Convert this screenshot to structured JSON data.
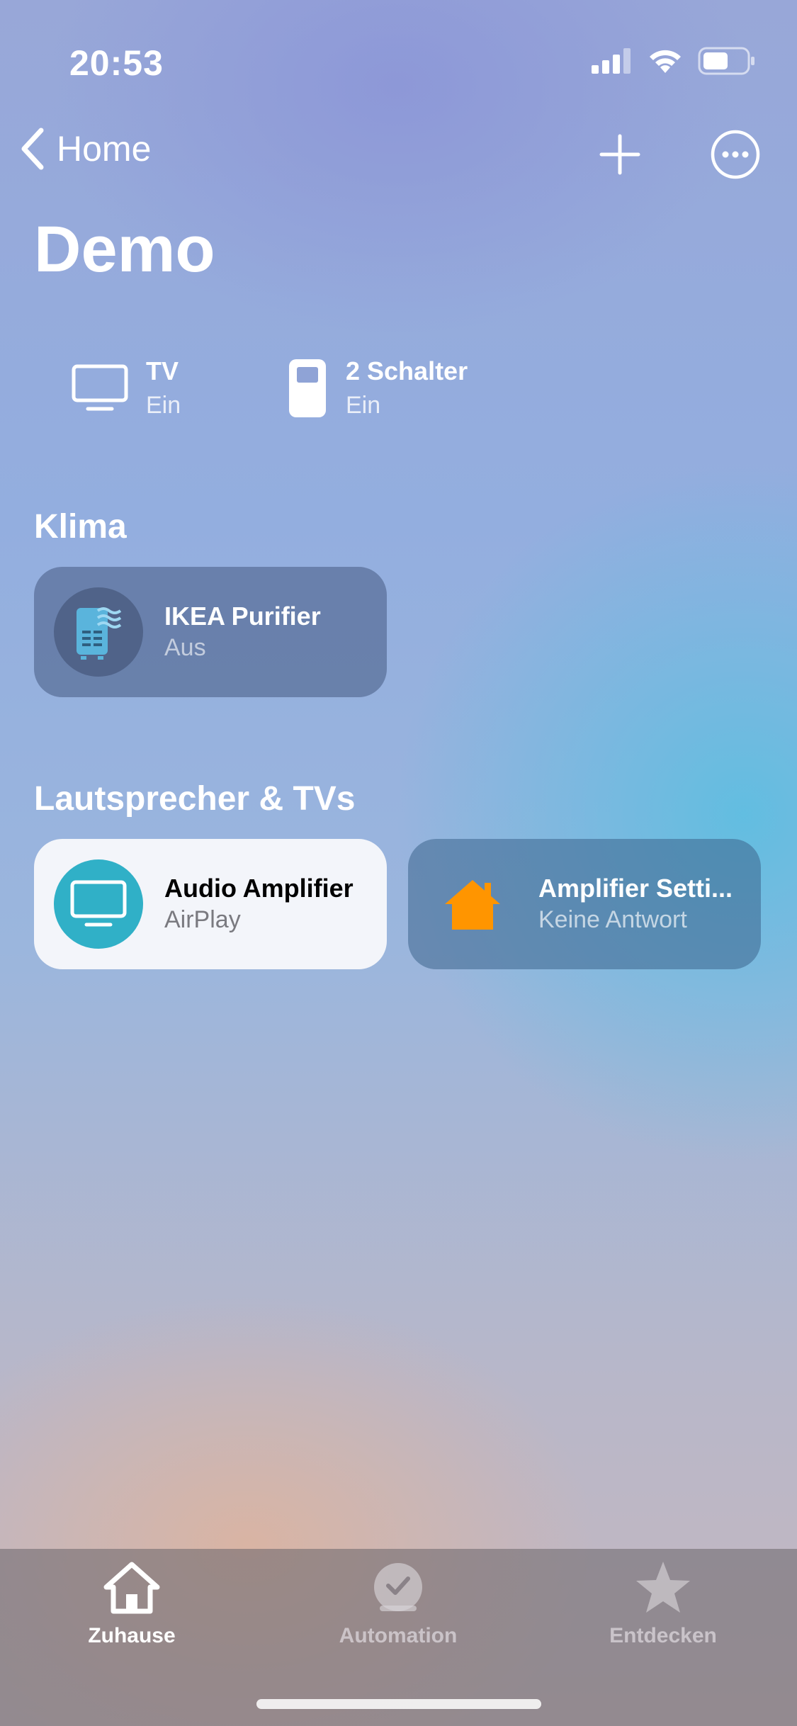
{
  "status_bar": {
    "time": "20:53"
  },
  "nav": {
    "back_label": "Home"
  },
  "page": {
    "title": "Demo"
  },
  "status_chips": [
    {
      "name": "TV",
      "state": "Ein",
      "icon": "tv-icon"
    },
    {
      "name": "2 Schalter",
      "state": "Ein",
      "icon": "switch-icon"
    }
  ],
  "sections": {
    "climate": {
      "title": "Klima",
      "tiles": [
        {
          "name": "IKEA Purifier",
          "state": "Aus",
          "icon": "air-purifier-icon"
        }
      ]
    },
    "speakers": {
      "title": "Lautsprecher & TVs",
      "tiles": [
        {
          "name": "Audio Amplifier",
          "state": "AirPlay",
          "icon": "tv-icon"
        },
        {
          "name": "Amplifier Setti...",
          "state": "Keine Antwort",
          "icon": "house-icon"
        }
      ]
    }
  },
  "tabbar": {
    "tabs": [
      {
        "label": "Zuhause",
        "icon": "house-icon",
        "selected": true
      },
      {
        "label": "Automation",
        "icon": "clock-check-icon",
        "selected": false
      },
      {
        "label": "Entdecken",
        "icon": "star-icon",
        "selected": false
      }
    ]
  },
  "colors": {
    "tile_icon_on": "#30b0c7",
    "house_orange": "#ff9500",
    "purifier_blue": "#5ab4dc"
  }
}
